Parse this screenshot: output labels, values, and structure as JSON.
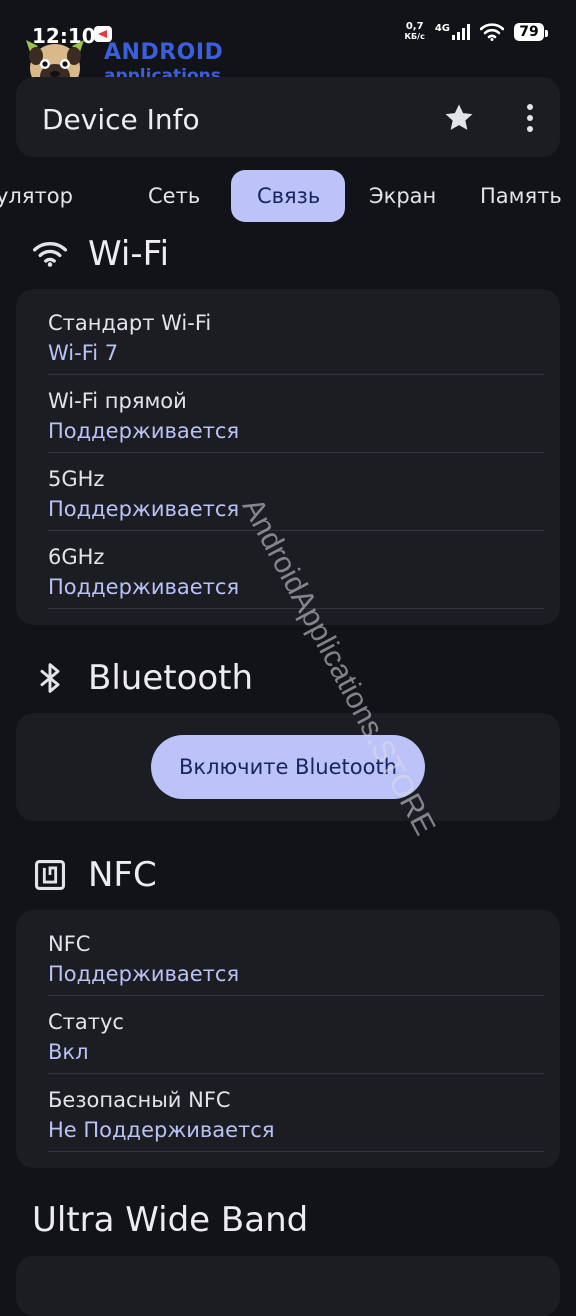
{
  "status_bar": {
    "time": "12:10",
    "speed_value": "0,7",
    "speed_unit": "КБ/с",
    "network": "4G",
    "battery": "79"
  },
  "watermark": {
    "logo_title": "ANDROID",
    "logo_subtitle": "applications",
    "diagonal_text": "AndroidApplications.STORE"
  },
  "app_bar": {
    "title": "Device Info",
    "star_icon": "star-icon",
    "menu_icon": "more-vert-icon"
  },
  "tabs": [
    {
      "label": "улятор",
      "active": false
    },
    {
      "label": "Сеть",
      "active": false
    },
    {
      "label": "Связь",
      "active": true
    },
    {
      "label": "Экран",
      "active": false
    },
    {
      "label": "Память",
      "active": false
    }
  ],
  "wifi": {
    "title": "Wi-Fi",
    "icon": "wifi-icon",
    "rows": [
      {
        "label": "Стандарт Wi-Fi",
        "value": "Wi-Fi 7"
      },
      {
        "label": "Wi-Fi прямой",
        "value": "Поддерживается"
      },
      {
        "label": "5GHz",
        "value": "Поддерживается"
      },
      {
        "label": "6GHz",
        "value": "Поддерживается"
      }
    ]
  },
  "bluetooth": {
    "title": "Bluetooth",
    "icon": "bluetooth-icon",
    "button_label": "Включите Bluetooth"
  },
  "nfc": {
    "title": "NFC",
    "icon": "nfc-icon",
    "rows": [
      {
        "label": "NFC",
        "value": "Поддерживается"
      },
      {
        "label": "Статус",
        "value": "Вкл"
      },
      {
        "label": "Безопасный NFC",
        "value": "Не Поддерживается"
      }
    ]
  },
  "uwb": {
    "title": "Ultra Wide Band"
  },
  "colors": {
    "background": "#121318",
    "card": "#1c1d23",
    "accent": "#bcc3f8",
    "value_text": "#b9c2f5"
  }
}
